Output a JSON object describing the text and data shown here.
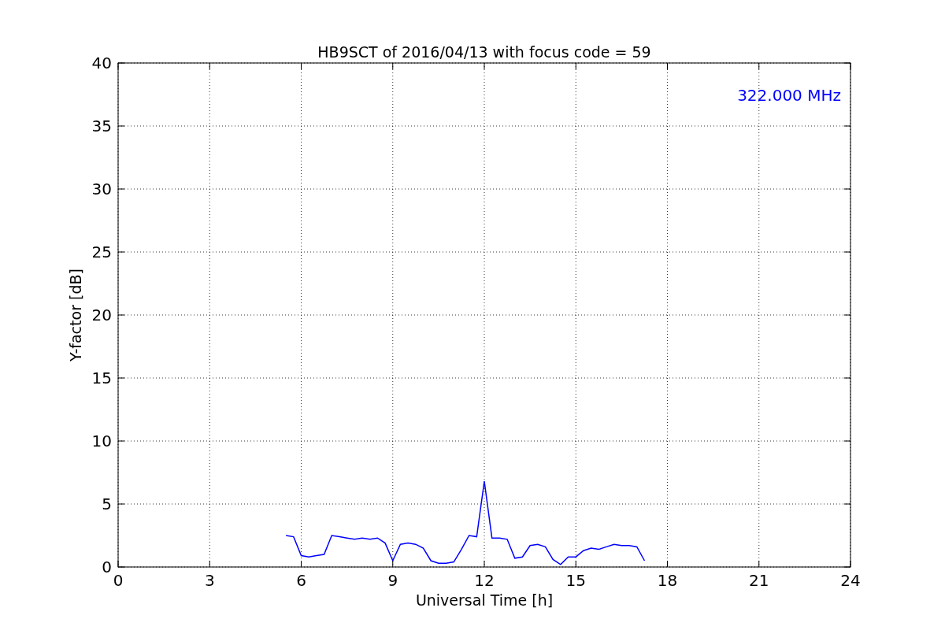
{
  "chart_data": {
    "type": "line",
    "title": "HB9SCT of 2016/04/13 with focus code = 59",
    "xlabel": "Universal Time [h]",
    "ylabel": "Y-factor [dB]",
    "x": [
      5.5,
      5.75,
      6.0,
      6.25,
      6.5,
      6.75,
      7.0,
      7.25,
      7.5,
      7.75,
      8.0,
      8.25,
      8.5,
      8.75,
      9.0,
      9.25,
      9.5,
      9.75,
      10.0,
      10.25,
      10.5,
      10.75,
      11.0,
      11.25,
      11.5,
      11.75,
      12.0,
      12.25,
      12.5,
      12.75,
      13.0,
      13.25,
      13.5,
      13.75,
      14.0,
      14.25,
      14.5,
      14.75,
      15.0,
      15.25,
      15.5,
      15.75,
      16.0,
      16.25,
      16.5,
      16.75,
      17.0,
      17.25
    ],
    "series": [
      {
        "name": "322.000 MHz",
        "color": "#0000ff",
        "values": [
          2.5,
          2.4,
          0.9,
          0.8,
          0.9,
          1.0,
          2.5,
          2.4,
          2.3,
          2.2,
          2.3,
          2.2,
          2.3,
          1.9,
          0.5,
          1.8,
          1.9,
          1.8,
          1.5,
          0.5,
          0.3,
          0.3,
          0.4,
          1.4,
          2.5,
          2.4,
          6.8,
          2.3,
          2.3,
          2.2,
          0.7,
          0.8,
          1.7,
          1.8,
          1.6,
          0.6,
          0.2,
          0.8,
          0.8,
          1.3,
          1.5,
          1.4,
          1.6,
          1.8,
          1.7,
          1.7,
          1.6,
          0.5
        ]
      }
    ],
    "grid": true,
    "xlim": [
      0,
      24
    ],
    "ylim": [
      0,
      40
    ],
    "xticks": [
      0,
      3,
      6,
      9,
      12,
      15,
      18,
      21,
      24
    ],
    "yticks": [
      0,
      5,
      10,
      15,
      20,
      25,
      30,
      35,
      40
    ]
  }
}
